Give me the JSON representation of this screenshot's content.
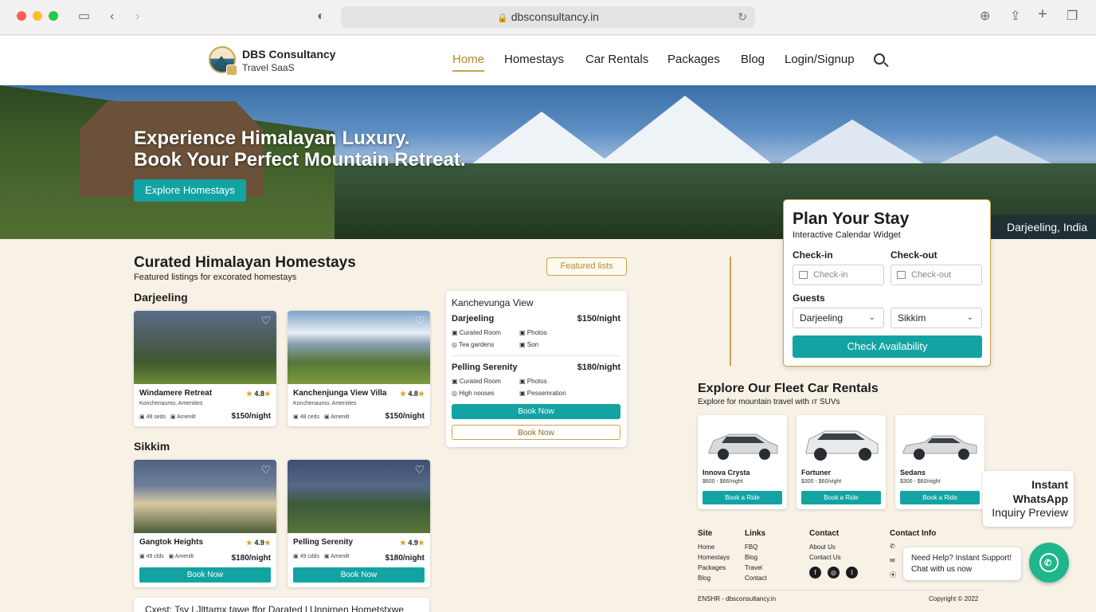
{
  "browser": {
    "url": "dbsconsultancy.in"
  },
  "header": {
    "brand": "DBS Consultancy",
    "brand_sub": "Travel SaaS",
    "nav": [
      "Home",
      "Homestays",
      "Car Rentals",
      "Packages",
      "Blog",
      "Login/Signup"
    ]
  },
  "hero": {
    "title_line1": "Experience Himalayan Luxury.",
    "title_line2": "Book Your Perfect Mountain Retreat.",
    "cta": "Explore Homestays",
    "location": "Darjeeling, India"
  },
  "homestays": {
    "title": "Curated Himalayan Homestays",
    "subtitle": "Featured listings for excorated homestays",
    "featured_btn": "Featured lists",
    "regions": [
      {
        "name": "Darjeeling",
        "cards": [
          {
            "name": "Windamere Retreat",
            "rating": "4.8",
            "meta": "Konchenaumo, Amenities",
            "beds": "48 seds",
            "amen": "Amenilt",
            "price": "$150/night"
          },
          {
            "name": "Kanchenjunga View Villa",
            "rating": "4.8",
            "meta": "Konchenaumo, Amenities",
            "beds": "48 ceds",
            "amen": "Amenilt",
            "price": "$150/night"
          }
        ]
      },
      {
        "name": "Sikkim",
        "cards": [
          {
            "name": "Gangtok Heights",
            "rating": "4.9",
            "beds": "49 clds",
            "amen": "Amenilt",
            "price": "$180/night",
            "book": "Book Now"
          },
          {
            "name": "Pelling Serenity",
            "rating": "4.9",
            "beds": "49 cdds",
            "amen": "Amenilt",
            "price": "$180/night",
            "book": "Book Now"
          }
        ]
      }
    ],
    "bottom_card_text": "Cxest: Tsy l Jlttamx tawe ffor Darated l Unnirnen Hometstxwe"
  },
  "featured": {
    "heading": "Kanchevunga View",
    "items": [
      {
        "name": "Darjeeling",
        "price": "$150/night",
        "f1": "Curated Room",
        "f2": "Photos",
        "f3": "Tea gardens",
        "f4": "Son"
      },
      {
        "name": "Pelling Serenity",
        "price": "$180/night",
        "f1": "Curated Room",
        "f2": "Photos",
        "f3": "High nooses",
        "f4": "Pessemration"
      }
    ],
    "book1": "Book Now",
    "book2": "Book Now"
  },
  "plan": {
    "title": "Plan Your Stay",
    "subtitle": "Interactive Calendar Widget",
    "checkin_label": "Check-in",
    "checkout_label": "Check-out",
    "checkin_placeholder": "Check-in",
    "checkout_placeholder": "Check-out",
    "guests_label": "Guests",
    "guest_sel1": "Darjeeling",
    "guest_sel2": "Sikkim",
    "cta": "Check Availability"
  },
  "fleet": {
    "title": "Explore Our Fleet Car Rentals",
    "subtitle": "Explore for mountain travel with ıт SUVs",
    "cars": [
      {
        "name": "Innova Crysta",
        "price": "$600 - $66/night",
        "btn": "Book a Ride"
      },
      {
        "name": "Fortuner",
        "price": "$300 - $60/vight",
        "btn": "Book a Ride"
      },
      {
        "name": "Sedans",
        "price": "$300 - $60/night",
        "btn": "Book a Ride"
      }
    ]
  },
  "footer": {
    "site_h": "Site",
    "site": [
      "Home",
      "Homestays",
      "Packages",
      "Blog"
    ],
    "links_h": "Links",
    "links": [
      "FBQ",
      "Blog",
      "Travel",
      "Contact"
    ],
    "contact_h": "Contact",
    "contact": [
      "About Us",
      "Contact Us"
    ],
    "info_h": "Contact Info",
    "left": "ENSHR - dbsconsultancy.in",
    "copyright": "Copyright © 2022"
  },
  "whatsapp": {
    "l1": "Instant",
    "l2": "WhatsApp",
    "l3": "Inquiry Preview",
    "tip1": "Need Help? Instant Support!",
    "tip2": "Chat with us now"
  },
  "colors": {
    "teal": "#13a3a3",
    "gold": "#c9a24b",
    "cream": "#f7f1e6",
    "whatsapp": "#1fb68c"
  }
}
